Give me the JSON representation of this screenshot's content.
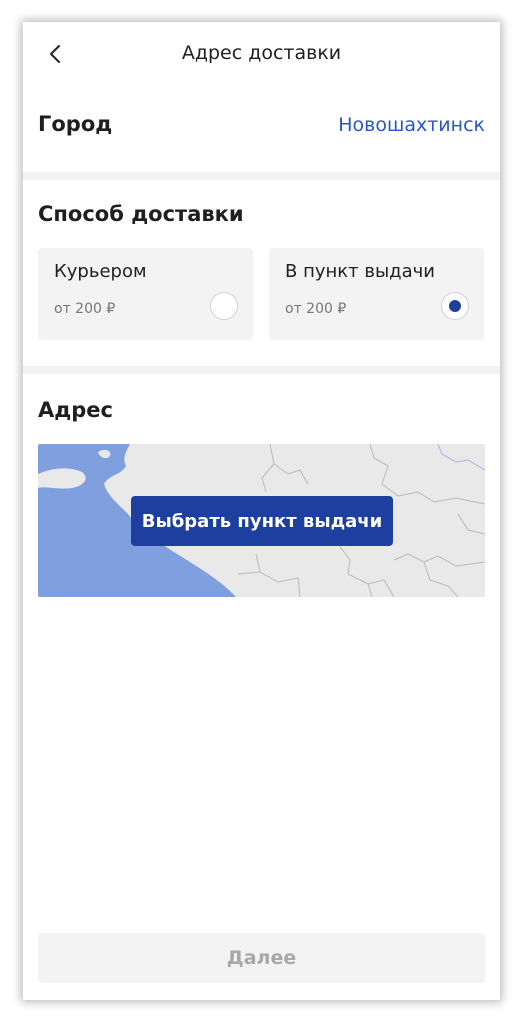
{
  "header": {
    "back_icon": "chevron-left-icon",
    "title": "Адрес доставки"
  },
  "city": {
    "label": "Город",
    "value": "Новошахтинск"
  },
  "delivery": {
    "title": "Способ доставки",
    "options": [
      {
        "name": "Курьером",
        "price": "от 200 ₽",
        "selected": false
      },
      {
        "name": "В пункт выдачи",
        "price": "от 200 ₽",
        "selected": true
      }
    ]
  },
  "address": {
    "title": "Адрес",
    "map_button": "Выбрать пункт выдачи"
  },
  "footer": {
    "next_label": "Далее"
  },
  "colors": {
    "accent": "#1d3f9f",
    "link": "#2a56c6",
    "water": "#7f9fde",
    "land": "#e9e9e9"
  }
}
